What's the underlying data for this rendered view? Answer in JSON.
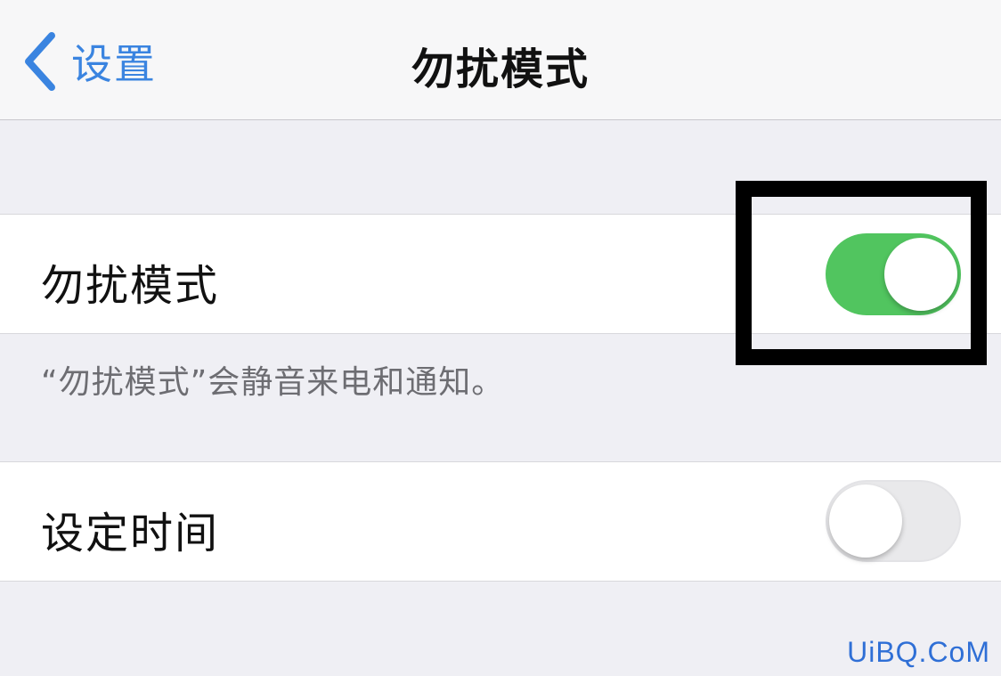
{
  "navbar": {
    "back_label": "设置",
    "title": "勿扰模式"
  },
  "dnd_cell": {
    "label": "勿扰模式",
    "toggle_on": true
  },
  "dnd_note": "“勿扰模式”会静音来电和通知。",
  "schedule_cell": {
    "label": "设定时间",
    "toggle_on": false
  },
  "watermark": "UiBQ.CoM",
  "colors": {
    "accent": "#3a84e0",
    "toggle_on": "#51c55f",
    "toggle_off": "#e9e9eb",
    "background": "#efeff4"
  },
  "icons": {
    "back": "chevron-left-icon"
  }
}
